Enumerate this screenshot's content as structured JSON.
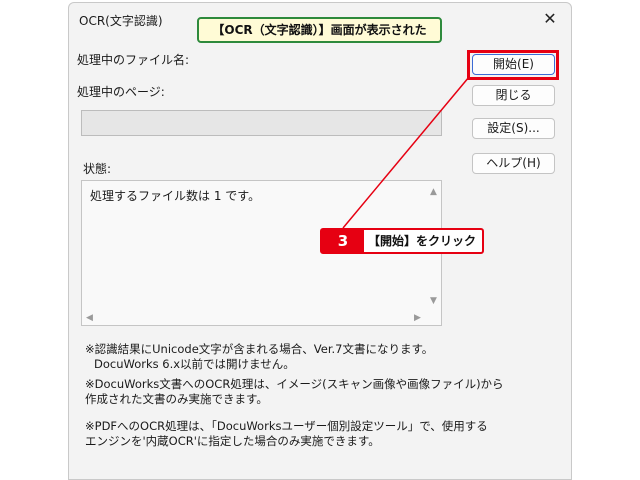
{
  "dialog": {
    "title": "OCR(文字認識)",
    "processing_file_label": "処理中のファイル名:",
    "processing_page_label": "処理中のページ:",
    "status_label": "状態:",
    "status_text": "処理するファイル数は 1 です。",
    "progress_percent": 0,
    "buttons": {
      "start": "開始(E)",
      "close": "閉じる",
      "settings": "設定(S)...",
      "help": "ヘルプ(H)"
    },
    "notes": [
      {
        "line1": "※認識結果にUnicode文字が含まれる場合、Ver.7文書になります。",
        "line2": "DocuWorks 6.x以前では開けません。"
      },
      {
        "line1": "※DocuWorks文書へのOCR処理は、イメージ(スキャン画像や画像ファイル)から",
        "line2": "作成された文書のみ実施できます。"
      },
      {
        "line1": "※PDFへのOCR処理は、「DocuWorksユーザー個別設定ツール」で、使用する",
        "line2": "エンジンを'内蔵OCR'に指定した場合のみ実施できます。"
      }
    ]
  },
  "annotations": {
    "banner": "【OCR（文字認識）】画面が表示された",
    "step_number": "3",
    "step_text": "【開始】をクリック",
    "highlight_color": "#e60012",
    "banner_border_color": "#2e8a3c"
  },
  "icons": {
    "close": "close-icon",
    "scroll_up": "arrow-up-icon",
    "scroll_down": "arrow-down-icon",
    "scroll_left": "arrow-left-icon",
    "scroll_right": "arrow-right-icon"
  }
}
